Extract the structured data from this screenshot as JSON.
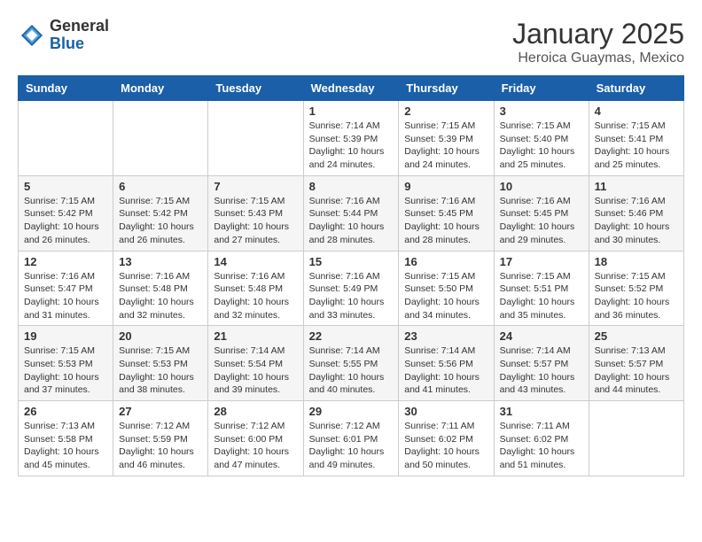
{
  "logo": {
    "general": "General",
    "blue": "Blue"
  },
  "title": "January 2025",
  "location": "Heroica Guaymas, Mexico",
  "days_of_week": [
    "Sunday",
    "Monday",
    "Tuesday",
    "Wednesday",
    "Thursday",
    "Friday",
    "Saturday"
  ],
  "weeks": [
    [
      {
        "day": "",
        "info": ""
      },
      {
        "day": "",
        "info": ""
      },
      {
        "day": "",
        "info": ""
      },
      {
        "day": "1",
        "info": "Sunrise: 7:14 AM\nSunset: 5:39 PM\nDaylight: 10 hours\nand 24 minutes."
      },
      {
        "day": "2",
        "info": "Sunrise: 7:15 AM\nSunset: 5:39 PM\nDaylight: 10 hours\nand 24 minutes."
      },
      {
        "day": "3",
        "info": "Sunrise: 7:15 AM\nSunset: 5:40 PM\nDaylight: 10 hours\nand 25 minutes."
      },
      {
        "day": "4",
        "info": "Sunrise: 7:15 AM\nSunset: 5:41 PM\nDaylight: 10 hours\nand 25 minutes."
      }
    ],
    [
      {
        "day": "5",
        "info": "Sunrise: 7:15 AM\nSunset: 5:42 PM\nDaylight: 10 hours\nand 26 minutes."
      },
      {
        "day": "6",
        "info": "Sunrise: 7:15 AM\nSunset: 5:42 PM\nDaylight: 10 hours\nand 26 minutes."
      },
      {
        "day": "7",
        "info": "Sunrise: 7:15 AM\nSunset: 5:43 PM\nDaylight: 10 hours\nand 27 minutes."
      },
      {
        "day": "8",
        "info": "Sunrise: 7:16 AM\nSunset: 5:44 PM\nDaylight: 10 hours\nand 28 minutes."
      },
      {
        "day": "9",
        "info": "Sunrise: 7:16 AM\nSunset: 5:45 PM\nDaylight: 10 hours\nand 28 minutes."
      },
      {
        "day": "10",
        "info": "Sunrise: 7:16 AM\nSunset: 5:45 PM\nDaylight: 10 hours\nand 29 minutes."
      },
      {
        "day": "11",
        "info": "Sunrise: 7:16 AM\nSunset: 5:46 PM\nDaylight: 10 hours\nand 30 minutes."
      }
    ],
    [
      {
        "day": "12",
        "info": "Sunrise: 7:16 AM\nSunset: 5:47 PM\nDaylight: 10 hours\nand 31 minutes."
      },
      {
        "day": "13",
        "info": "Sunrise: 7:16 AM\nSunset: 5:48 PM\nDaylight: 10 hours\nand 32 minutes."
      },
      {
        "day": "14",
        "info": "Sunrise: 7:16 AM\nSunset: 5:48 PM\nDaylight: 10 hours\nand 32 minutes."
      },
      {
        "day": "15",
        "info": "Sunrise: 7:16 AM\nSunset: 5:49 PM\nDaylight: 10 hours\nand 33 minutes."
      },
      {
        "day": "16",
        "info": "Sunrise: 7:15 AM\nSunset: 5:50 PM\nDaylight: 10 hours\nand 34 minutes."
      },
      {
        "day": "17",
        "info": "Sunrise: 7:15 AM\nSunset: 5:51 PM\nDaylight: 10 hours\nand 35 minutes."
      },
      {
        "day": "18",
        "info": "Sunrise: 7:15 AM\nSunset: 5:52 PM\nDaylight: 10 hours\nand 36 minutes."
      }
    ],
    [
      {
        "day": "19",
        "info": "Sunrise: 7:15 AM\nSunset: 5:53 PM\nDaylight: 10 hours\nand 37 minutes."
      },
      {
        "day": "20",
        "info": "Sunrise: 7:15 AM\nSunset: 5:53 PM\nDaylight: 10 hours\nand 38 minutes."
      },
      {
        "day": "21",
        "info": "Sunrise: 7:14 AM\nSunset: 5:54 PM\nDaylight: 10 hours\nand 39 minutes."
      },
      {
        "day": "22",
        "info": "Sunrise: 7:14 AM\nSunset: 5:55 PM\nDaylight: 10 hours\nand 40 minutes."
      },
      {
        "day": "23",
        "info": "Sunrise: 7:14 AM\nSunset: 5:56 PM\nDaylight: 10 hours\nand 41 minutes."
      },
      {
        "day": "24",
        "info": "Sunrise: 7:14 AM\nSunset: 5:57 PM\nDaylight: 10 hours\nand 43 minutes."
      },
      {
        "day": "25",
        "info": "Sunrise: 7:13 AM\nSunset: 5:57 PM\nDaylight: 10 hours\nand 44 minutes."
      }
    ],
    [
      {
        "day": "26",
        "info": "Sunrise: 7:13 AM\nSunset: 5:58 PM\nDaylight: 10 hours\nand 45 minutes."
      },
      {
        "day": "27",
        "info": "Sunrise: 7:12 AM\nSunset: 5:59 PM\nDaylight: 10 hours\nand 46 minutes."
      },
      {
        "day": "28",
        "info": "Sunrise: 7:12 AM\nSunset: 6:00 PM\nDaylight: 10 hours\nand 47 minutes."
      },
      {
        "day": "29",
        "info": "Sunrise: 7:12 AM\nSunset: 6:01 PM\nDaylight: 10 hours\nand 49 minutes."
      },
      {
        "day": "30",
        "info": "Sunrise: 7:11 AM\nSunset: 6:02 PM\nDaylight: 10 hours\nand 50 minutes."
      },
      {
        "day": "31",
        "info": "Sunrise: 7:11 AM\nSunset: 6:02 PM\nDaylight: 10 hours\nand 51 minutes."
      },
      {
        "day": "",
        "info": ""
      }
    ]
  ]
}
